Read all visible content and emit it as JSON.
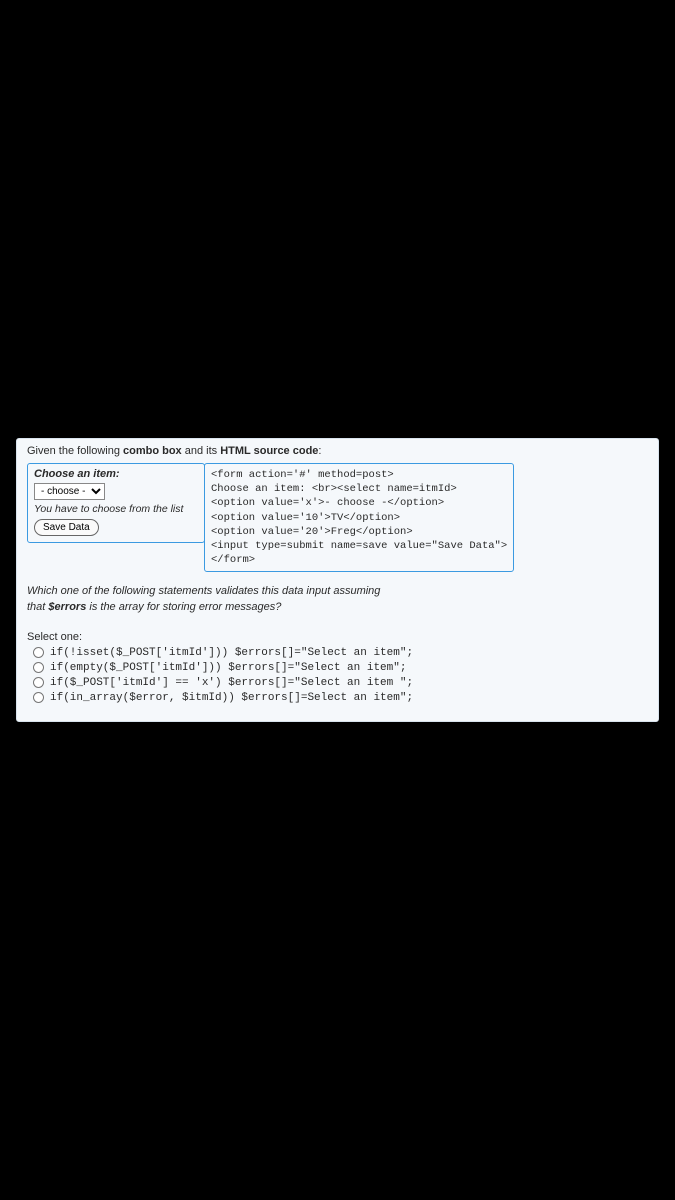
{
  "intro": {
    "p1": "Given the following ",
    "b1": "combo box",
    "p2": " and its ",
    "b2": "HTML source code",
    "p3": ":"
  },
  "leftbox": {
    "label": "Choose an item:",
    "select_value": "- choose -",
    "hint": "You have to choose from the list",
    "button": "Save Data"
  },
  "code": {
    "l1": "<form action='#' method=post>",
    "l2": "Choose an item: <br><select name=itmId>",
    "l3": "<option value='x'>- choose -</option>",
    "l4": "<option value='10'>TV</option>",
    "l5": "<option value='20'>Freg</option>",
    "l6": "<input type=submit name=save value=\"Save Data\">",
    "l7": "</form>"
  },
  "question": {
    "line1": "Which one of the following statements validates this data input assuming",
    "line2a": "that ",
    "line2b": "$errors",
    "line2c": " is the array for storing error messages?"
  },
  "select_one": "Select one:",
  "options": {
    "a": "if(!isset($_POST['itmId'])) $errors[]=\"Select an item\";",
    "b": "if(empty($_POST['itmId'])) $errors[]=\"Select an item\";",
    "c": "if($_POST['itmId'] == 'x') $errors[]=\"Select an item \";",
    "d": "if(in_array($error, $itmId)) $errors[]=Select an item\";"
  }
}
